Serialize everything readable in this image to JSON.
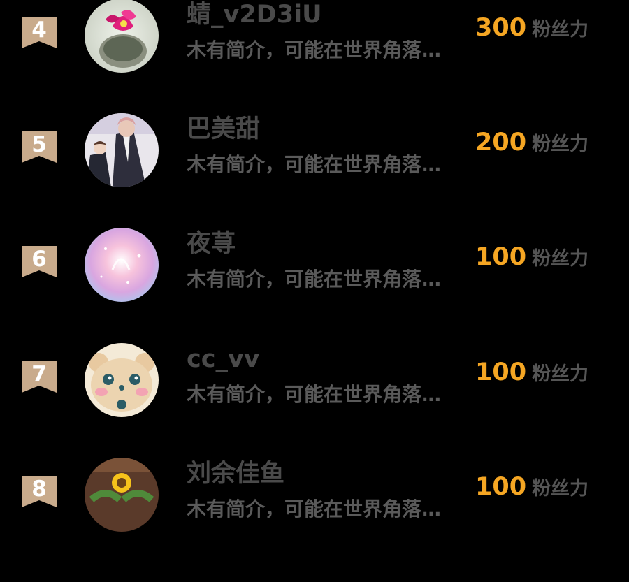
{
  "colors": {
    "background": "#000000",
    "rank_badge": "#c9ab8c",
    "name_text": "#4a4a4a",
    "intro_text": "#5a5a5a",
    "power_number": "#f5a623",
    "power_unit": "#555555"
  },
  "fans": [
    {
      "rank": "4",
      "name": "蜻_v2D3iU",
      "intro": "木有简介，可能在世界角落…",
      "power": "300",
      "power_unit": "粉丝力",
      "avatar": "avatar-pink-flower-vase"
    },
    {
      "rank": "5",
      "name": "巴美甜",
      "intro": "木有简介，可能在世界角落…",
      "power": "200",
      "power_unit": "粉丝力",
      "avatar": "avatar-anime-suits"
    },
    {
      "rank": "6",
      "name": "夜荨",
      "intro": "木有简介，可能在世界角落…",
      "power": "100",
      "power_unit": "粉丝力",
      "avatar": "avatar-pink-galaxy"
    },
    {
      "rank": "7",
      "name": "cc_vv",
      "intro": "木有简介，可能在世界角落…",
      "power": "100",
      "power_unit": "粉丝力",
      "avatar": "avatar-cute-bear"
    },
    {
      "rank": "8",
      "name": "刘余佳鱼",
      "intro": "木有简介，可能在世界角落…",
      "power": "100",
      "power_unit": "粉丝力",
      "avatar": "avatar-sunflower"
    }
  ]
}
